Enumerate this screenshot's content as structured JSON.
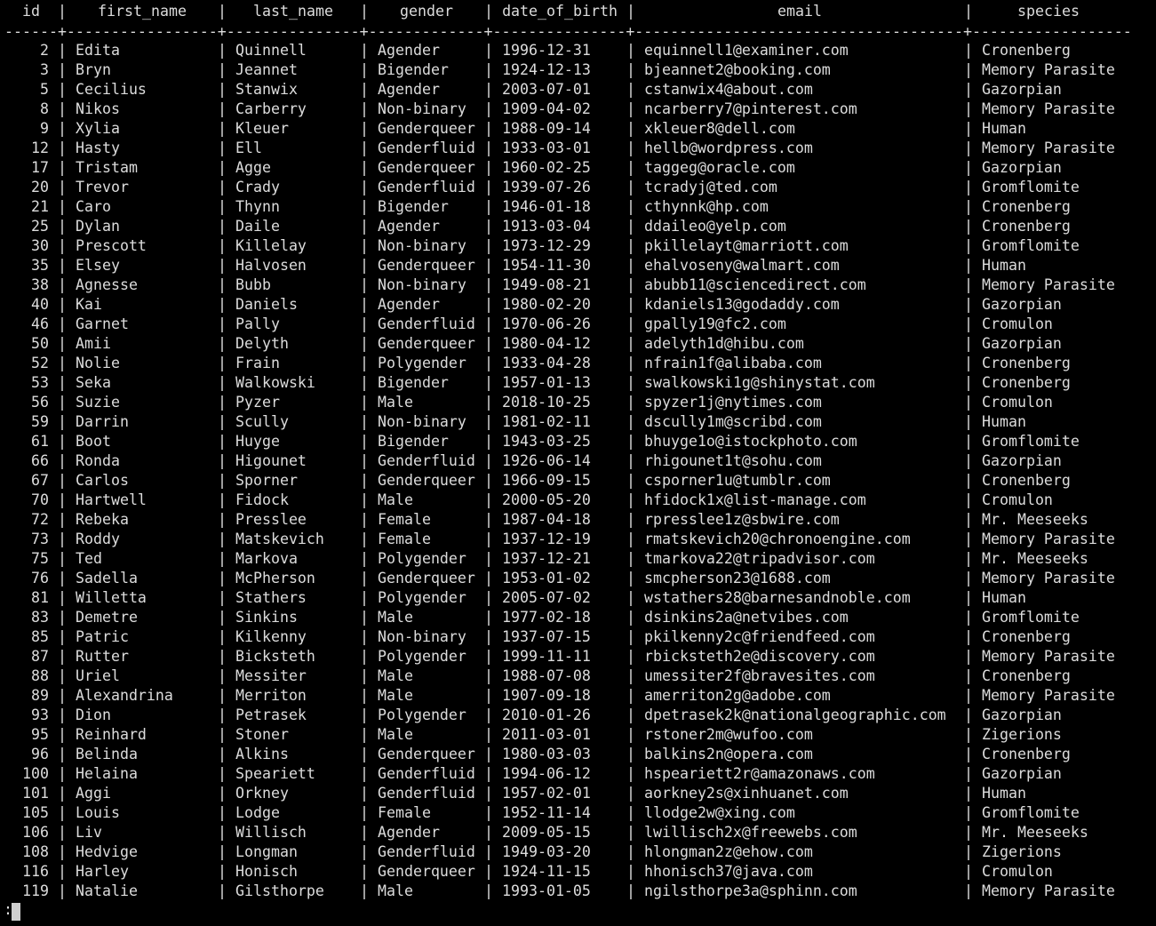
{
  "columns": [
    "id",
    "first_name",
    "last_name",
    "gender",
    "date_of_birth",
    "email",
    "species"
  ],
  "separator_line": "------+-----------------+---------------+-------------+---------------+-------------------------------------+------------------",
  "rows": [
    [
      "2",
      "Edita",
      "Quinnell",
      "Agender",
      "1996-12-31",
      "equinnell1@examiner.com",
      "Cronenberg"
    ],
    [
      "3",
      "Bryn",
      "Jeannet",
      "Bigender",
      "1924-12-13",
      "bjeannet2@booking.com",
      "Memory Parasite"
    ],
    [
      "5",
      "Cecilius",
      "Stanwix",
      "Agender",
      "2003-07-01",
      "cstanwix4@about.com",
      "Gazorpian"
    ],
    [
      "8",
      "Nikos",
      "Carberry",
      "Non-binary",
      "1909-04-02",
      "ncarberry7@pinterest.com",
      "Memory Parasite"
    ],
    [
      "9",
      "Xylia",
      "Kleuer",
      "Genderqueer",
      "1988-09-14",
      "xkleuer8@dell.com",
      "Human"
    ],
    [
      "12",
      "Hasty",
      "Ell",
      "Genderfluid",
      "1933-03-01",
      "hellb@wordpress.com",
      "Memory Parasite"
    ],
    [
      "17",
      "Tristam",
      "Agge",
      "Genderqueer",
      "1960-02-25",
      "taggeg@oracle.com",
      "Gazorpian"
    ],
    [
      "20",
      "Trevor",
      "Crady",
      "Genderfluid",
      "1939-07-26",
      "tcradyj@ted.com",
      "Gromflomite"
    ],
    [
      "21",
      "Caro",
      "Thynn",
      "Bigender",
      "1946-01-18",
      "cthynnk@hp.com",
      "Cronenberg"
    ],
    [
      "25",
      "Dylan",
      "Daile",
      "Agender",
      "1913-03-04",
      "ddaileo@yelp.com",
      "Cronenberg"
    ],
    [
      "30",
      "Prescott",
      "Killelay",
      "Non-binary",
      "1973-12-29",
      "pkillelayt@marriott.com",
      "Gromflomite"
    ],
    [
      "35",
      "Elsey",
      "Halvosen",
      "Genderqueer",
      "1954-11-30",
      "ehalvoseny@walmart.com",
      "Human"
    ],
    [
      "38",
      "Agnesse",
      "Bubb",
      "Non-binary",
      "1949-08-21",
      "abubb11@sciencedirect.com",
      "Memory Parasite"
    ],
    [
      "40",
      "Kai",
      "Daniels",
      "Agender",
      "1980-02-20",
      "kdaniels13@godaddy.com",
      "Gazorpian"
    ],
    [
      "46",
      "Garnet",
      "Pally",
      "Genderfluid",
      "1970-06-26",
      "gpally19@fc2.com",
      "Cromulon"
    ],
    [
      "50",
      "Amii",
      "Delyth",
      "Genderqueer",
      "1980-04-12",
      "adelyth1d@hibu.com",
      "Gazorpian"
    ],
    [
      "52",
      "Nolie",
      "Frain",
      "Polygender",
      "1933-04-28",
      "nfrain1f@alibaba.com",
      "Cronenberg"
    ],
    [
      "53",
      "Seka",
      "Walkowski",
      "Bigender",
      "1957-01-13",
      "swalkowski1g@shinystat.com",
      "Cronenberg"
    ],
    [
      "56",
      "Suzie",
      "Pyzer",
      "Male",
      "2018-10-25",
      "spyzer1j@nytimes.com",
      "Cromulon"
    ],
    [
      "59",
      "Darrin",
      "Scully",
      "Non-binary",
      "1981-02-11",
      "dscully1m@scribd.com",
      "Human"
    ],
    [
      "61",
      "Boot",
      "Huyge",
      "Bigender",
      "1943-03-25",
      "bhuyge1o@istockphoto.com",
      "Gromflomite"
    ],
    [
      "66",
      "Ronda",
      "Higounet",
      "Genderfluid",
      "1926-06-14",
      "rhigounet1t@sohu.com",
      "Gazorpian"
    ],
    [
      "67",
      "Carlos",
      "Sporner",
      "Genderqueer",
      "1966-09-15",
      "csporner1u@tumblr.com",
      "Cronenberg"
    ],
    [
      "70",
      "Hartwell",
      "Fidock",
      "Male",
      "2000-05-20",
      "hfidock1x@list-manage.com",
      "Cromulon"
    ],
    [
      "72",
      "Rebeka",
      "Presslee",
      "Female",
      "1987-04-18",
      "rpresslee1z@sbwire.com",
      "Mr. Meeseeks"
    ],
    [
      "73",
      "Roddy",
      "Matskevich",
      "Female",
      "1937-12-19",
      "rmatskevich20@chronoengine.com",
      "Memory Parasite"
    ],
    [
      "75",
      "Ted",
      "Markova",
      "Polygender",
      "1937-12-21",
      "tmarkova22@tripadvisor.com",
      "Mr. Meeseeks"
    ],
    [
      "76",
      "Sadella",
      "McPherson",
      "Genderqueer",
      "1953-01-02",
      "smcpherson23@1688.com",
      "Memory Parasite"
    ],
    [
      "81",
      "Willetta",
      "Stathers",
      "Polygender",
      "2005-07-02",
      "wstathers28@barnesandnoble.com",
      "Human"
    ],
    [
      "83",
      "Demetre",
      "Sinkins",
      "Male",
      "1977-02-18",
      "dsinkins2a@netvibes.com",
      "Gromflomite"
    ],
    [
      "85",
      "Patric",
      "Kilkenny",
      "Non-binary",
      "1937-07-15",
      "pkilkenny2c@friendfeed.com",
      "Cronenberg"
    ],
    [
      "87",
      "Rutter",
      "Bicksteth",
      "Polygender",
      "1999-11-11",
      "rbicksteth2e@discovery.com",
      "Memory Parasite"
    ],
    [
      "88",
      "Uriel",
      "Messiter",
      "Male",
      "1988-07-08",
      "umessiter2f@bravesites.com",
      "Cronenberg"
    ],
    [
      "89",
      "Alexandrina",
      "Merriton",
      "Male",
      "1907-09-18",
      "amerriton2g@adobe.com",
      "Memory Parasite"
    ],
    [
      "93",
      "Dion",
      "Petrasek",
      "Polygender",
      "2010-01-26",
      "dpetrasek2k@nationalgeographic.com",
      "Gazorpian"
    ],
    [
      "95",
      "Reinhard",
      "Stoner",
      "Male",
      "2011-03-01",
      "rstoner2m@wufoo.com",
      "Zigerions"
    ],
    [
      "96",
      "Belinda",
      "Alkins",
      "Genderqueer",
      "1980-03-03",
      "balkins2n@opera.com",
      "Cronenberg"
    ],
    [
      "100",
      "Helaina",
      "Speariett",
      "Genderfluid",
      "1994-06-12",
      "hspeariett2r@amazonaws.com",
      "Gazorpian"
    ],
    [
      "101",
      "Aggi",
      "Orkney",
      "Genderfluid",
      "1957-02-01",
      "aorkney2s@xinhuanet.com",
      "Human"
    ],
    [
      "105",
      "Louis",
      "Lodge",
      "Female",
      "1952-11-14",
      "llodge2w@xing.com",
      "Gromflomite"
    ],
    [
      "106",
      "Liv",
      "Willisch",
      "Agender",
      "2009-05-15",
      "lwillisch2x@freewebs.com",
      "Mr. Meeseeks"
    ],
    [
      "108",
      "Hedvige",
      "Longman",
      "Genderfluid",
      "1949-03-20",
      "hlongman2z@ehow.com",
      "Zigerions"
    ],
    [
      "116",
      "Harley",
      "Honisch",
      "Genderqueer",
      "1924-11-15",
      "hhonisch37@java.com",
      "Cromulon"
    ],
    [
      "119",
      "Natalie",
      "Gilsthorpe",
      "Male",
      "1993-01-05",
      "ngilsthorpe3a@sphinn.com",
      "Memory Parasite"
    ]
  ],
  "pager_prompt": ":"
}
